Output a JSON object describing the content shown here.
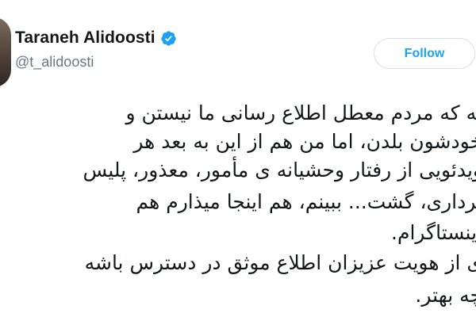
{
  "profile": {
    "display_name": "Taraneh Alidoosti",
    "handle": "@t_alidoosti",
    "verified_icon": "verified-badge-icon",
    "accent_color": "#1da1f2"
  },
  "actions": {
    "follow_label": "Follow"
  },
  "tweet": {
    "lines": [
      "به که مردم معطل اطلاع رسانی ما نیستن و",
      "خودشون بلدن، اما من هم از این به بعد هر",
      "ویدئویی از رفتار وحشیانه ی مأمور، معذور، پلیس",
      "برداری، گشت... ببینم، هم اینجا میذارم هم",
      "اینستاگرام.",
      "ی از هویت عزیزان اطلاع موثق در دسترس باشه",
      "چه بهتر."
    ]
  }
}
